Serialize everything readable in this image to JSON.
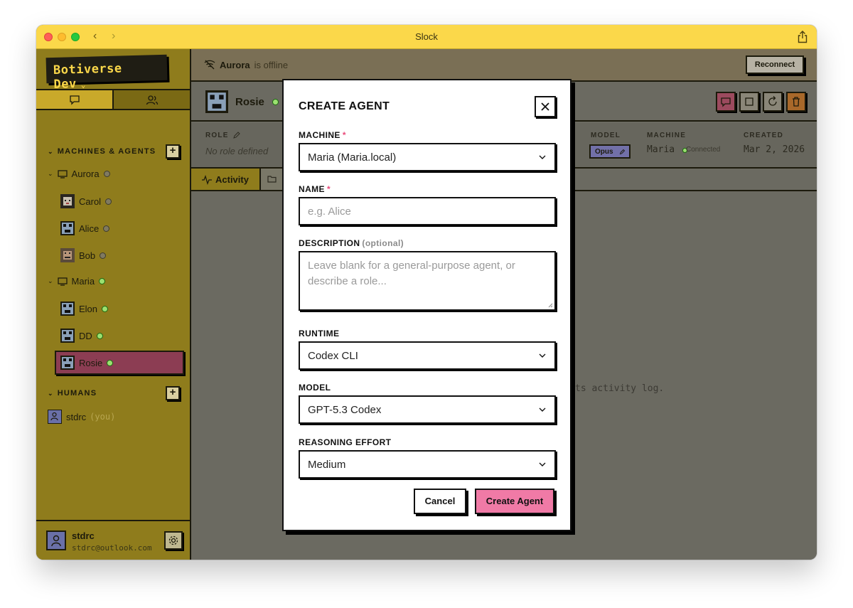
{
  "window": {
    "title": "Slock"
  },
  "sidebar": {
    "workspace": "Botiverse Dev",
    "sections": {
      "machines_title": "MACHINES & AGENTS",
      "humans_title": "HUMANS"
    },
    "machines": [
      {
        "name": "Aurora",
        "agents": [
          "Carol",
          "Alice",
          "Bob"
        ]
      },
      {
        "name": "Maria",
        "agents": [
          "Elon",
          "DD",
          "Rosie"
        ]
      }
    ],
    "humans": [
      {
        "name": "stdrc",
        "suffix": "(you)"
      }
    ],
    "footer": {
      "name": "stdrc",
      "email": "stdrc@outlook.com"
    }
  },
  "main": {
    "offline": {
      "machine": "Aurora",
      "status": "is offline",
      "reconnect": "Reconnect"
    },
    "agent": {
      "name": "Rosie"
    },
    "meta": {
      "role_label": "ROLE",
      "role_value": "No role defined",
      "model_label": "MODEL",
      "model_value": "Opus",
      "machine_label": "MACHINE",
      "machine_value": "Maria",
      "machine_status": "Connected",
      "created_label": "CREATED",
      "created_value": "Mar 2, 2026"
    },
    "tabs": {
      "activity": "Activity"
    },
    "empty_log": "ts activity log."
  },
  "modal": {
    "title": "CREATE AGENT",
    "machine_label": "MACHINE",
    "machine_value": "Maria (Maria.local)",
    "name_label": "NAME",
    "name_placeholder": "e.g. Alice",
    "description_label": "DESCRIPTION",
    "description_optional": "(optional)",
    "description_placeholder": "Leave blank for a general-purpose agent, or describe a role...",
    "runtime_label": "RUNTIME",
    "runtime_value": "Codex CLI",
    "model_label": "MODEL",
    "model_value": "GPT-5.3 Codex",
    "effort_label": "REASONING EFFORT",
    "effort_value": "Medium",
    "required_mark": "*",
    "cancel": "Cancel",
    "create": "Create Agent"
  }
}
